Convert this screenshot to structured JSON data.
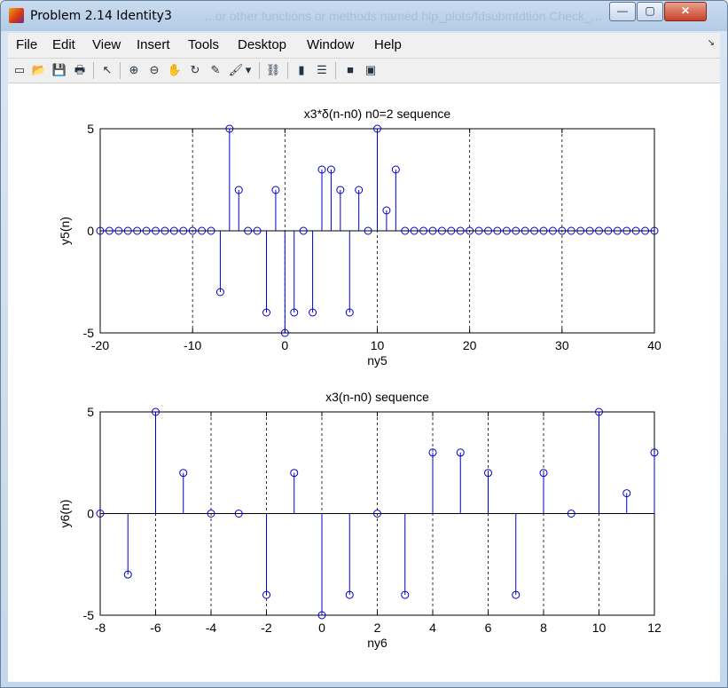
{
  "window": {
    "title": "Problem 2.14 Identity3",
    "ghost_text": "...or other functions or methods named  hlp_plots/fdsubmtdtion Check_...",
    "buttons": {
      "minimize": "—",
      "maximize": "▢",
      "close": "✕"
    }
  },
  "menubar": {
    "items": [
      "File",
      "Edit",
      "View",
      "Insert",
      "Tools",
      "Desktop",
      "Window",
      "Help"
    ],
    "corner_glyph": "↘"
  },
  "toolbar": {
    "icons": [
      {
        "name": "new-figure-icon",
        "glyph": "▭"
      },
      {
        "name": "open-file-icon",
        "glyph": "📂"
      },
      {
        "name": "save-icon",
        "glyph": "💾"
      },
      {
        "name": "print-icon",
        "glyph": "🖶"
      },
      {
        "name": "edit-plot-arrow-icon",
        "glyph": "↖"
      },
      {
        "name": "zoom-in-icon",
        "glyph": "⊕"
      },
      {
        "name": "zoom-out-icon",
        "glyph": "⊖"
      },
      {
        "name": "pan-hand-icon",
        "glyph": "✋"
      },
      {
        "name": "rotate-3d-icon",
        "glyph": "↻"
      },
      {
        "name": "data-cursor-icon",
        "glyph": "✎"
      },
      {
        "name": "brush-icon",
        "glyph": "🖌"
      },
      {
        "name": "brush-dropdown-icon",
        "glyph": "▾"
      },
      {
        "name": "link-plot-icon",
        "glyph": "⛓"
      },
      {
        "name": "colorbar-icon",
        "glyph": "▮"
      },
      {
        "name": "legend-icon",
        "glyph": "☰"
      },
      {
        "name": "hide-plot-tools-icon",
        "glyph": "■"
      },
      {
        "name": "show-plot-tools-icon",
        "glyph": "▣"
      }
    ]
  },
  "chart_data": [
    {
      "type": "stem",
      "title": "x3*δ(n-n0) n0=2 sequence",
      "xlabel": "ny5",
      "ylabel": "y5(n)",
      "xlim": [
        -20,
        40
      ],
      "ylim": [
        -5,
        5
      ],
      "xticks": [
        -20,
        -10,
        0,
        10,
        20,
        30,
        40
      ],
      "yticks": [
        -5,
        0,
        5
      ],
      "grid": "vertical dashed",
      "color": "#0000cc",
      "x": [
        -20,
        -19,
        -18,
        -17,
        -16,
        -15,
        -14,
        -13,
        -12,
        -11,
        -10,
        -9,
        -8,
        -7,
        -6,
        -5,
        -4,
        -3,
        -2,
        -1,
        0,
        1,
        2,
        3,
        4,
        5,
        6,
        7,
        8,
        9,
        10,
        11,
        12,
        13,
        14,
        15,
        16,
        17,
        18,
        19,
        20,
        21,
        22,
        23,
        24,
        25,
        26,
        27,
        28,
        29,
        30,
        31,
        32,
        33,
        34,
        35,
        36,
        37,
        38,
        39,
        40
      ],
      "y": [
        0,
        0,
        0,
        0,
        0,
        0,
        0,
        0,
        0,
        0,
        0,
        0,
        0,
        -3,
        5,
        2,
        0,
        0,
        -4,
        2,
        -5,
        -4,
        0,
        -4,
        3,
        3,
        2,
        -4,
        2,
        0,
        5,
        1,
        3,
        0,
        0,
        0,
        0,
        0,
        0,
        0,
        0,
        0,
        0,
        0,
        0,
        0,
        0,
        0,
        0,
        0,
        0,
        0,
        0,
        0,
        0,
        0,
        0,
        0,
        0,
        0,
        0
      ]
    },
    {
      "type": "stem",
      "title": "x3(n-n0) sequence",
      "xlabel": "ny6",
      "ylabel": "y6(n)",
      "xlim": [
        -8,
        12
      ],
      "ylim": [
        -5,
        5
      ],
      "xticks": [
        -8,
        -6,
        -4,
        -2,
        0,
        2,
        4,
        6,
        8,
        10,
        12
      ],
      "yticks": [
        -5,
        0,
        5
      ],
      "grid": "vertical dashed",
      "color": "#0000cc",
      "x": [
        -8,
        -7,
        -6,
        -5,
        -4,
        -3,
        -2,
        -1,
        0,
        1,
        2,
        3,
        4,
        5,
        6,
        7,
        8,
        9,
        10,
        11,
        12
      ],
      "y": [
        0,
        -3,
        5,
        2,
        0,
        0,
        -4,
        2,
        -5,
        -4,
        0,
        -4,
        3,
        3,
        2,
        -4,
        2,
        0,
        5,
        1,
        3
      ]
    }
  ]
}
